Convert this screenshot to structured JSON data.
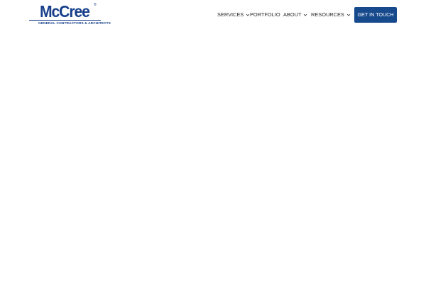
{
  "logo": {
    "wordmark": "McCree",
    "registered_mark": "®",
    "tagline": "GENERAL CONTRACTORS & ARCHITECTS",
    "color": "#173f8a"
  },
  "nav": {
    "items": [
      {
        "label": "SERVICES",
        "has_dropdown": true
      },
      {
        "label": "PORTFOLIO",
        "has_dropdown": false
      },
      {
        "label": "ABOUT",
        "has_dropdown": true
      },
      {
        "label": "RESOURCES",
        "has_dropdown": true
      }
    ],
    "text_color": "#2b2b2b"
  },
  "cta": {
    "label": "GET IN TOUCH",
    "background": "#174a8c",
    "text_color": "#ffffff"
  },
  "page": {
    "background": "#ffffff"
  }
}
